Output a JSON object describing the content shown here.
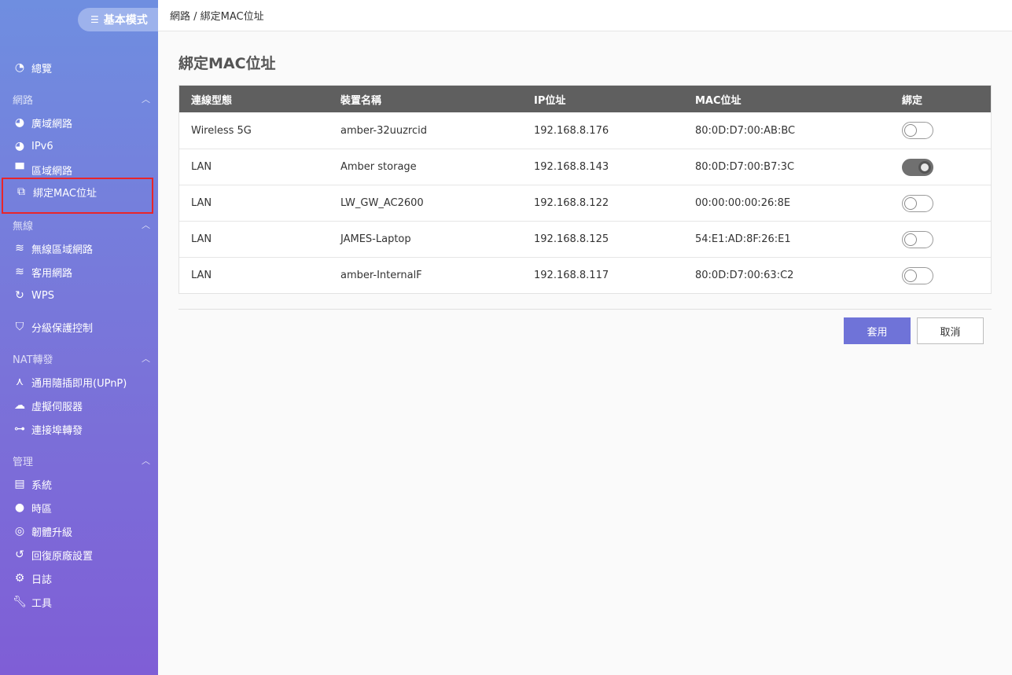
{
  "sidebar": {
    "mode_label": "基本模式",
    "overview": "總覽",
    "sections": {
      "network": "網路",
      "wireless": "無線",
      "nat": "NAT轉發",
      "management": "管理"
    },
    "items": {
      "wan": "廣域網路",
      "ipv6": "IPv6",
      "lan": "區域網路",
      "mac_bind": "綁定MAC位址",
      "wlan": "無線區域網路",
      "guest": "客用網路",
      "wps": "WPS",
      "parental": "分級保護控制",
      "upnp": "通用隨插即用(UPnP)",
      "virtual_server": "虛擬伺服器",
      "port_forward": "連接埠轉發",
      "system": "系統",
      "timezone": "時區",
      "firmware": "韌體升級",
      "factory_reset": "回復原廠設置",
      "log": "日誌",
      "tools": "工具"
    }
  },
  "header": {
    "breadcrumb": "網路 / 綁定MAC位址"
  },
  "main": {
    "title": "綁定MAC位址",
    "columns": [
      "連線型態",
      "裝置名稱",
      "IP位址",
      "MAC位址",
      "綁定"
    ],
    "rows": [
      {
        "type": "Wireless 5G",
        "name": "amber-32uuzrcid",
        "ip": "192.168.8.176",
        "mac": "80:0D:D7:00:AB:BC",
        "bound": false
      },
      {
        "type": "LAN",
        "name": "Amber storage",
        "ip": "192.168.8.143",
        "mac": "80:0D:D7:00:B7:3C",
        "bound": true
      },
      {
        "type": "LAN",
        "name": "LW_GW_AC2600",
        "ip": "192.168.8.122",
        "mac": "00:00:00:00:26:8E",
        "bound": false
      },
      {
        "type": "LAN",
        "name": "JAMES-Laptop",
        "ip": "192.168.8.125",
        "mac": "54:E1:AD:8F:26:E1",
        "bound": false
      },
      {
        "type": "LAN",
        "name": "amber-InternalF",
        "ip": "192.168.8.117",
        "mac": "80:0D:D7:00:63:C2",
        "bound": false
      }
    ],
    "apply_label": "套用",
    "cancel_label": "取消"
  },
  "colors": {
    "accent": "#6f73d8",
    "table_header": "#5f5f5f",
    "highlight_frame": "#e8252a"
  }
}
